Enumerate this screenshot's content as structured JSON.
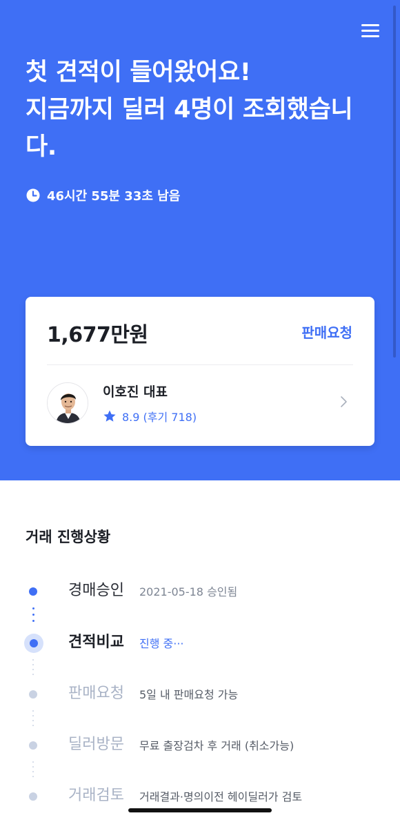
{
  "header": {
    "menu_icon": "hamburger-menu-icon",
    "headline_lines": [
      "첫 견적이 들어왔어요!",
      "지금까지 딜러 4명이 조회했습니",
      "다."
    ],
    "timer_icon": "clock-icon",
    "timer_text": "46시간 55분 33초 남음"
  },
  "quote_card": {
    "price": "1,677만원",
    "sell_request_label": "판매요청",
    "dealer": {
      "avatar_icon": "dealer-avatar",
      "name": "이호진 대표",
      "rating_icon": "star-icon",
      "rating_text": "8.9 (후기 718)",
      "chevron_icon": "chevron-right-icon"
    }
  },
  "progress": {
    "title": "거래 진행상황",
    "steps": [
      {
        "name": "경매승인",
        "desc": "2021-05-18 승인됨",
        "state": "done"
      },
      {
        "name": "견적비교",
        "desc": "진행 중···",
        "state": "current"
      },
      {
        "name": "판매요청",
        "desc": "5일 내 판매요청 가능",
        "state": "pending"
      },
      {
        "name": "딜러방문",
        "desc": "무료 출장검차 후 거래 (취소가능)",
        "state": "pending"
      },
      {
        "name": "거래검토",
        "desc": "거래결과·명의이전 헤이딜러가 검토",
        "state": "pending"
      }
    ]
  },
  "colors": {
    "primary": "#3f6ff5",
    "pending_dot": "#c9d2e3",
    "current_halo": "#d6e1fb"
  }
}
